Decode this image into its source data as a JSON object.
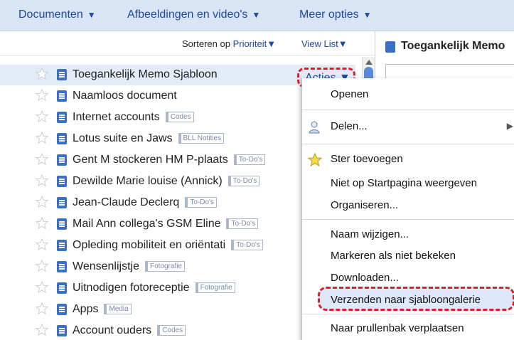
{
  "topbar": {
    "menus": [
      {
        "label": "Documenten",
        "caret": "▼"
      },
      {
        "label": "Afbeeldingen en video's",
        "caret": "▼"
      },
      {
        "label": "Meer opties",
        "caret": "▼"
      }
    ]
  },
  "sortbar": {
    "sort_prefix": "Sorteren op",
    "sort_value": "Prioriteit▼",
    "view_label": "View List▼"
  },
  "documents": [
    {
      "title": "Toegankelijk Memo Sjabloon",
      "label": ""
    },
    {
      "title": "Naamloos document",
      "label": ""
    },
    {
      "title": "Internet accounts",
      "label": "Codes"
    },
    {
      "title": "Lotus suite en Jaws",
      "label": "BLL Notities"
    },
    {
      "title": "Gent M stockeren HM P-plaats",
      "label": "To-Do's"
    },
    {
      "title": "Dewilde Marie louise (Annick)",
      "label": "To-Do's"
    },
    {
      "title": "Jean-Claude Declerq",
      "label": "To-Do's"
    },
    {
      "title": "Mail Ann collega's GSM Eline",
      "label": "To-Do's"
    },
    {
      "title": "Opleding mobiliteit en oriëntati",
      "label": "To-Do's"
    },
    {
      "title": "Wensenlijstje",
      "label": "Fotografie"
    },
    {
      "title": "Uitnodigen fotoreceptie",
      "label": "Fotografie"
    },
    {
      "title": "Apps",
      "label": "Media"
    },
    {
      "title": "Account ouders",
      "label": "Codes"
    }
  ],
  "acties": {
    "label": "Acties ▼"
  },
  "preview": {
    "title": "Toegankelijk Memo"
  },
  "menu": {
    "open": "Openen",
    "share": "Delen...",
    "add_star": "Ster toevoegen",
    "not_on_start": "Niet op Startpagina weergeven",
    "organize": "Organiseren...",
    "rename": "Naam wijzigen...",
    "mark_unread": "Markeren als niet bekeken",
    "download": "Downloaden...",
    "send_template": "Verzenden naar sjabloongalerie",
    "trash": "Naar prullenbak verplaatsen"
  },
  "colors": {
    "accent": "#1c4aa0",
    "highlight_border": "#d8202a",
    "topbar_bg": "#d9e4f5"
  }
}
